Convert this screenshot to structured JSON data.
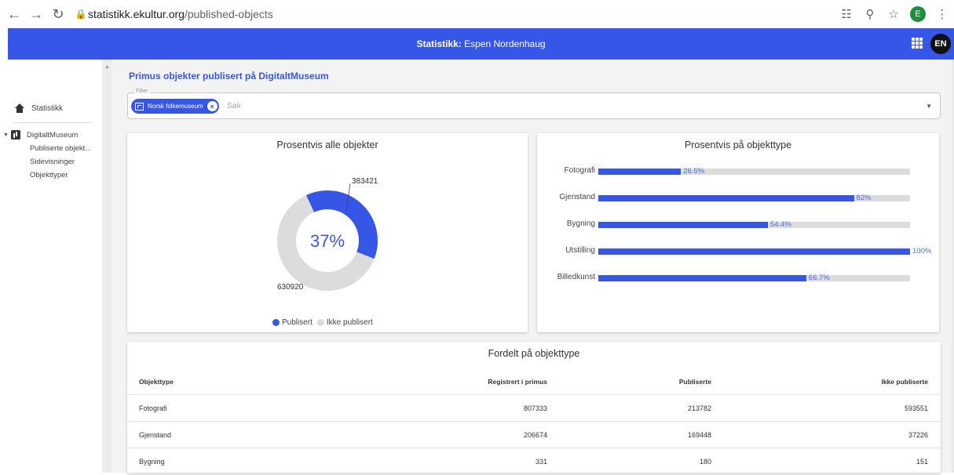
{
  "browser": {
    "url_host": "statistikk.ekultur.org",
    "url_path": "/published-objects",
    "profile_initial": "E"
  },
  "appbar": {
    "title_bold": "Statistikk:",
    "title_rest": " Espen Nordenhaug",
    "lang_label": "EN"
  },
  "sidebar": {
    "home_label": "Statistikk",
    "group_label": "DigitaltMuseum",
    "items": [
      "Publiserte objekt...",
      "Sidevisninger",
      "Objekttyper"
    ]
  },
  "page": {
    "title": "Primus objekter publisert på DigitaltMuseum",
    "filter_label": "Filter",
    "chip_label": "Norsk folkemuseum",
    "search_placeholder": "Søk"
  },
  "pie": {
    "title": "Prosentvis alle objekter",
    "center_label": "37%",
    "label_published": "383421",
    "label_unpublished": "630920",
    "legend": [
      {
        "label": "Publisert",
        "color": "#3656e8"
      },
      {
        "label": "Ikke publisert",
        "color": "#dcdcdc"
      }
    ]
  },
  "chart_data": [
    {
      "type": "pie",
      "title": "Prosentvis alle objekter",
      "categories": [
        "Publisert",
        "Ikke publisert"
      ],
      "values": [
        383421,
        630920
      ],
      "colors": [
        "#3656e8",
        "#dcdcdc"
      ],
      "center_label": "37%",
      "legend": "bottom"
    },
    {
      "type": "bar",
      "orientation": "horizontal",
      "title": "Prosentvis på objekttype",
      "categories": [
        "Fotografi",
        "Gjenstand",
        "Bygning",
        "Utstilling",
        "Billedkunst"
      ],
      "values": [
        26.5,
        82,
        54.4,
        100,
        66.7
      ],
      "value_labels": [
        "26.5%",
        "82%",
        "54.4%",
        "100%",
        "66.7%"
      ],
      "xlim": [
        0,
        100
      ],
      "colors": [
        "#3656e8",
        "#dcdcdc"
      ]
    }
  ],
  "table": {
    "title": "Fordelt på objekttype",
    "headers": [
      "Objekttype",
      "Registrert i primus",
      "Publiserte",
      "Ikke publiserte"
    ],
    "rows": [
      [
        "Fotografi",
        "807333",
        "213782",
        "593551"
      ],
      [
        "Gjenstand",
        "206674",
        "169448",
        "37226"
      ],
      [
        "Bygning",
        "331",
        "180",
        "151"
      ]
    ]
  }
}
